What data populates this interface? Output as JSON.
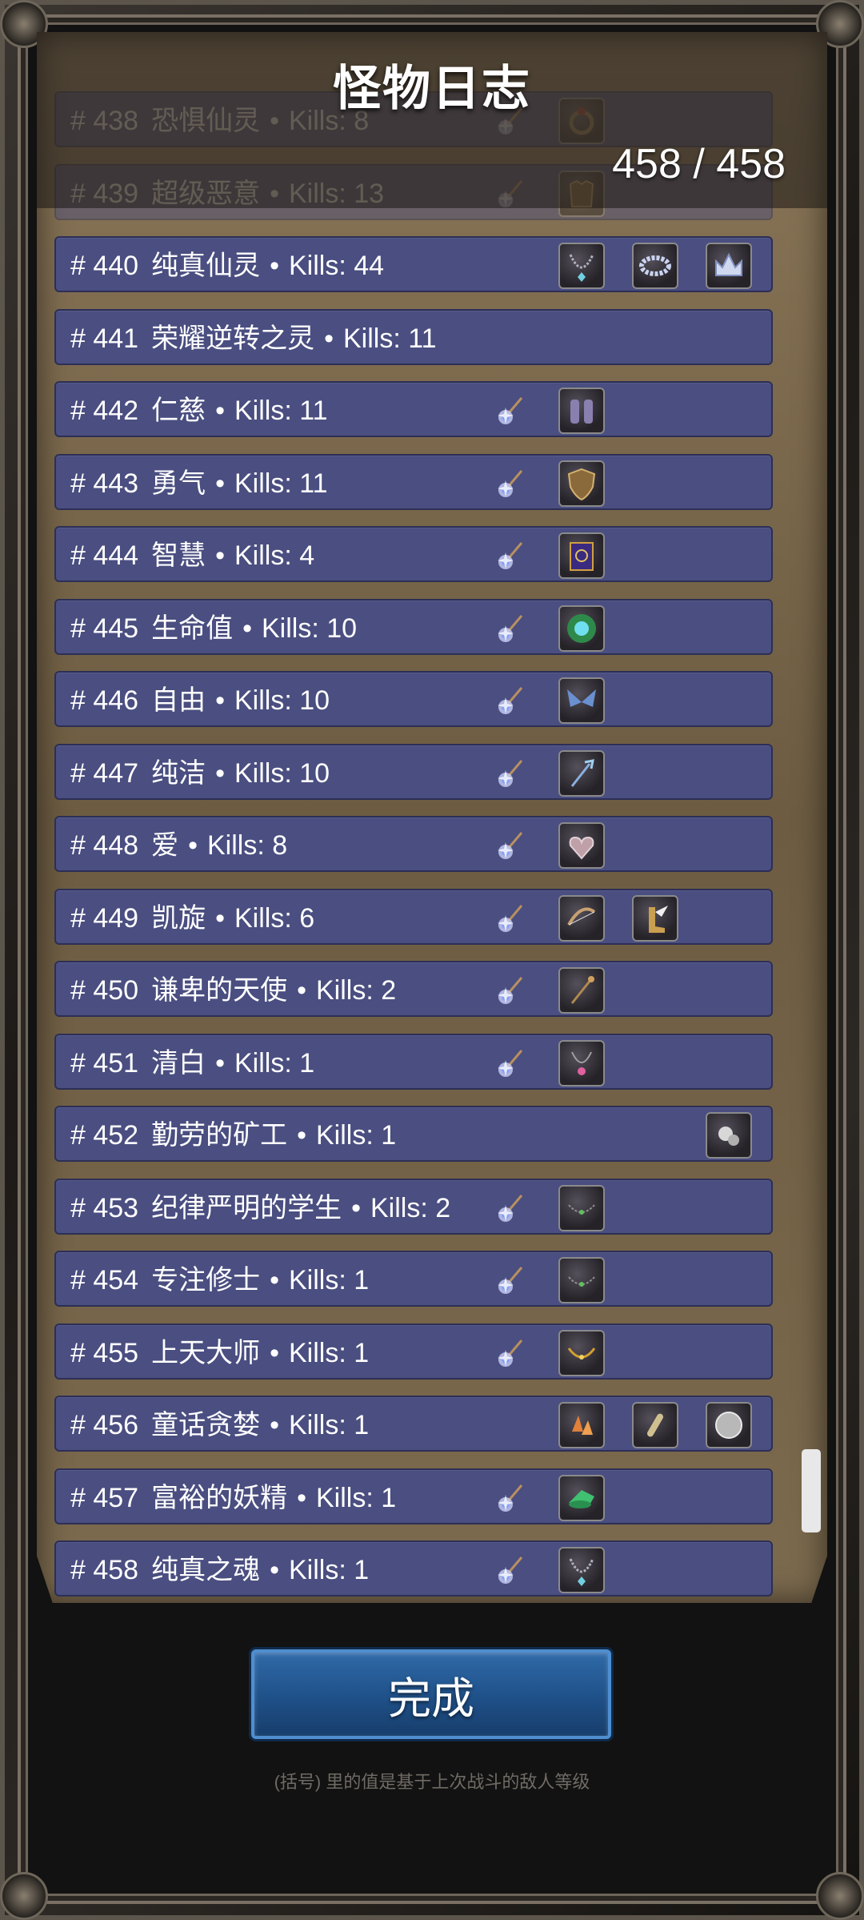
{
  "header": {
    "title": "怪物日志",
    "count": "458 / 458"
  },
  "rows": [
    {
      "num": "# 438",
      "name": "恐惧仙灵",
      "kills": "Kills: 8",
      "gem": true,
      "items": [
        {
          "icon": "ring-icon",
          "slot": 1
        }
      ],
      "faded": true
    },
    {
      "num": "# 439",
      "name": "超级恶意",
      "kills": "Kills: 13",
      "gem": true,
      "items": [
        {
          "icon": "armor-icon",
          "slot": 1
        }
      ],
      "faded": true
    },
    {
      "num": "# 440",
      "name": "纯真仙灵",
      "kills": "Kills: 44",
      "gem": false,
      "items": [
        {
          "icon": "necklace-icon",
          "slot": 1
        },
        {
          "icon": "bracelet-icon",
          "slot": 2
        },
        {
          "icon": "crown-icon",
          "slot": 3
        }
      ]
    },
    {
      "num": "# 441",
      "name": "荣耀逆转之灵",
      "kills": "Kills: 11",
      "gem": false,
      "items": []
    },
    {
      "num": "# 442",
      "name": "仁慈",
      "kills": "Kills: 11",
      "gem": true,
      "items": [
        {
          "icon": "gauntlets-icon",
          "slot": 1
        }
      ]
    },
    {
      "num": "# 443",
      "name": "勇气",
      "kills": "Kills: 11",
      "gem": true,
      "items": [
        {
          "icon": "shield-icon",
          "slot": 1
        }
      ]
    },
    {
      "num": "# 444",
      "name": "智慧",
      "kills": "Kills: 4",
      "gem": true,
      "items": [
        {
          "icon": "book-icon",
          "slot": 1
        }
      ]
    },
    {
      "num": "# 445",
      "name": "生命值",
      "kills": "Kills: 10",
      "gem": true,
      "items": [
        {
          "icon": "gem-orb-icon",
          "slot": 1
        }
      ]
    },
    {
      "num": "# 446",
      "name": "自由",
      "kills": "Kills: 10",
      "gem": true,
      "items": [
        {
          "icon": "wings-icon",
          "slot": 1
        }
      ]
    },
    {
      "num": "# 447",
      "name": "纯洁",
      "kills": "Kills: 10",
      "gem": true,
      "items": [
        {
          "icon": "trident-icon",
          "slot": 1
        }
      ]
    },
    {
      "num": "# 448",
      "name": "爱",
      "kills": "Kills: 8",
      "gem": true,
      "items": [
        {
          "icon": "heart-amulet-icon",
          "slot": 1
        }
      ]
    },
    {
      "num": "# 449",
      "name": "凯旋",
      "kills": "Kills: 6",
      "gem": true,
      "items": [
        {
          "icon": "bow-icon",
          "slot": 1
        },
        {
          "icon": "winged-boots-icon",
          "slot": 2
        }
      ]
    },
    {
      "num": "# 450",
      "name": "谦卑的天使",
      "kills": "Kills: 2",
      "gem": true,
      "items": [
        {
          "icon": "staff-icon",
          "slot": 1
        }
      ]
    },
    {
      "num": "# 451",
      "name": "清白",
      "kills": "Kills: 1",
      "gem": true,
      "items": [
        {
          "icon": "pendant-icon",
          "slot": 1
        }
      ]
    },
    {
      "num": "# 452",
      "name": "勤劳的矿工",
      "kills": "Kills: 1",
      "gem": false,
      "items": [
        {
          "icon": "ore-icon",
          "slot": 3
        }
      ]
    },
    {
      "num": "# 453",
      "name": "纪律严明的学生",
      "kills": "Kills: 2",
      "gem": true,
      "items": [
        {
          "icon": "chain-necklace-icon",
          "slot": 1
        }
      ]
    },
    {
      "num": "# 454",
      "name": "专注修士",
      "kills": "Kills: 1",
      "gem": true,
      "items": [
        {
          "icon": "chain-necklace-icon",
          "slot": 1
        }
      ]
    },
    {
      "num": "# 455",
      "name": "上天大师",
      "kills": "Kills: 1",
      "gem": true,
      "items": [
        {
          "icon": "gold-necklace-icon",
          "slot": 1
        }
      ]
    },
    {
      "num": "# 456",
      "name": "童话贪婪",
      "kills": "Kills: 1",
      "gem": false,
      "items": [
        {
          "icon": "crystal-shards-icon",
          "slot": 1
        },
        {
          "icon": "potion-vial-icon",
          "slot": 2
        },
        {
          "icon": "coin-icon",
          "slot": 3
        }
      ]
    },
    {
      "num": "# 457",
      "name": "富裕的妖精",
      "kills": "Kills: 1",
      "gem": true,
      "items": [
        {
          "icon": "green-hat-icon",
          "slot": 1
        }
      ]
    },
    {
      "num": "# 458",
      "name": "纯真之魂",
      "kills": "Kills: 1",
      "gem": true,
      "items": [
        {
          "icon": "necklace-icon",
          "slot": 1
        }
      ]
    }
  ],
  "footer": {
    "done_label": "完成",
    "note": "(括号) 里的值是基于上次战斗的敌人等级"
  },
  "colors": {
    "row_bg": "#4a4e80",
    "button_blue": "#1f5088",
    "accent": "#4f8ed0"
  }
}
